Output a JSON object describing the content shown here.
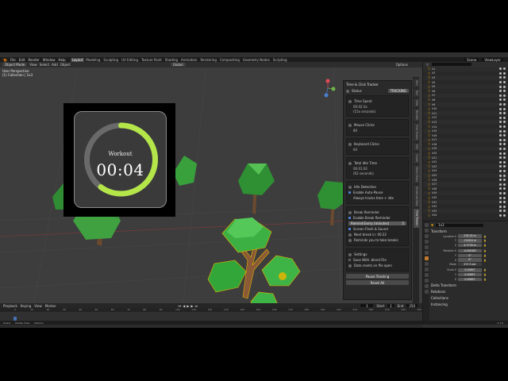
{
  "menubar": {
    "menu": [
      "File",
      "Edit",
      "Render",
      "Window",
      "Help"
    ],
    "workspaces": [
      {
        "label": "Layout",
        "active": true
      },
      {
        "label": "Modeling",
        "active": false
      },
      {
        "label": "Sculpting",
        "active": false
      },
      {
        "label": "UV Editing",
        "active": false
      },
      {
        "label": "Texture Paint",
        "active": false
      },
      {
        "label": "Shading",
        "active": false
      },
      {
        "label": "Animation",
        "active": false
      },
      {
        "label": "Rendering",
        "active": false
      },
      {
        "label": "Compositing",
        "active": false
      },
      {
        "label": "Geometry Nodes",
        "active": false
      },
      {
        "label": "Scripting",
        "active": false
      }
    ],
    "scene": "Scene",
    "view_layer": "ViewLayer"
  },
  "viewport": {
    "mode": "Object Mode",
    "menus": [
      "View",
      "Select",
      "Add",
      "Object"
    ],
    "orientation": "Global",
    "options": "Options",
    "info_line1": "User Perspective",
    "info_line2": "(1) Collection | 1x3"
  },
  "workout": {
    "title": "Workout",
    "time": "00:04",
    "progress": 0.6,
    "accent": "#b4e64a"
  },
  "npanel": {
    "title": "Time & Click Tracker",
    "status_label": "Status",
    "status_value": "TRACKING",
    "time_spent_label": "Time Spent",
    "time_spent_value": "00:02:3x",
    "time_spent_seconds": "(15x seconds)",
    "mouse_clicks_label": "Mouse Clicks",
    "mouse_clicks_value": "80",
    "keyboard_clicks_label": "Keyboard Clicks",
    "keyboard_clicks_value": "64",
    "idle_time_label": "Total Idle Time",
    "idle_time_value": "00:01:02",
    "idle_time_seconds": "(62 seconds)",
    "idle_detection_label": "Idle Detection",
    "enable_auto_pause": "Enable Auto-Pause",
    "always_track": "Always tracks time + idle",
    "break_reminder_label": "Break Reminder",
    "enable_break_reminder": "Enable Break Reminder",
    "remind_every_label": "Remind Every (minutes)",
    "remind_every_value": "5",
    "screen_flash": "Screen Flash & Sound",
    "next_break": "Next break in: 00:22",
    "reminder_hint": "Reminds you to take breaks",
    "settings_label": "Settings",
    "save_with_file": "Save With .blend File",
    "data_resets": "Data resets on file open",
    "pause_button": "Pause Tracking",
    "reset_button": "Reset All"
  },
  "sidetabs": [
    "Item",
    "Tool",
    "View",
    "Blendkit",
    "Time Tracker",
    "Edit",
    "Create",
    "Object Props",
    "Screencast Keys",
    "Time Tracker"
  ],
  "timeline": {
    "menus": [
      "Playback",
      "Keying",
      "View",
      "Marker"
    ],
    "current_frame": "1",
    "start_label": "Start",
    "start_value": "1",
    "end_label": "End",
    "end_value": "250",
    "ruler": [
      "0",
      "10",
      "20",
      "30",
      "40",
      "50",
      "60",
      "70",
      "80",
      "90",
      "100",
      "110",
      "120",
      "130",
      "140",
      "150",
      "160",
      "170",
      "180",
      "190",
      "200",
      "210",
      "220",
      "230",
      "240",
      "250"
    ]
  },
  "status_bar": [
    "Select",
    "Rotate View",
    "Options"
  ],
  "status_version": "4.1.0",
  "outliner": {
    "rows": [
      "lr1",
      "lr2",
      "lr3",
      "lr4",
      "lr5",
      "lr6",
      "lr7",
      "lr8",
      "lr9",
      "lr10",
      "lr11",
      "lr12",
      "lr13",
      "lr14",
      "lr15",
      "lr16",
      "lr17",
      "lr18",
      "lr19",
      "lr20",
      "lr21",
      "lr22",
      "lr23",
      "lr24",
      "lr25",
      "lr26",
      "lr27",
      "lr28",
      "lr29",
      "lr30",
      "lr31",
      "lr32",
      "lr33",
      "lr34"
    ]
  },
  "properties": {
    "object_name": "1x3",
    "transform_label": "Transform",
    "location_label": "Location X",
    "location": [
      "578.35 m",
      "-19.824 m",
      "4.7776 m"
    ],
    "rotation_label": "Rotation X",
    "rotation": [
      "-0.000587",
      "0°",
      "0°"
    ],
    "mode_label": "Mode",
    "mode_value": "XYZ Euler",
    "scale_label": "Scale X",
    "scale": [
      "0.00657",
      "0.00657",
      "0.00657"
    ],
    "delta_transform": "Delta Transform",
    "relations": "Relations",
    "collections": "Collections",
    "instancing": "Instancing"
  }
}
